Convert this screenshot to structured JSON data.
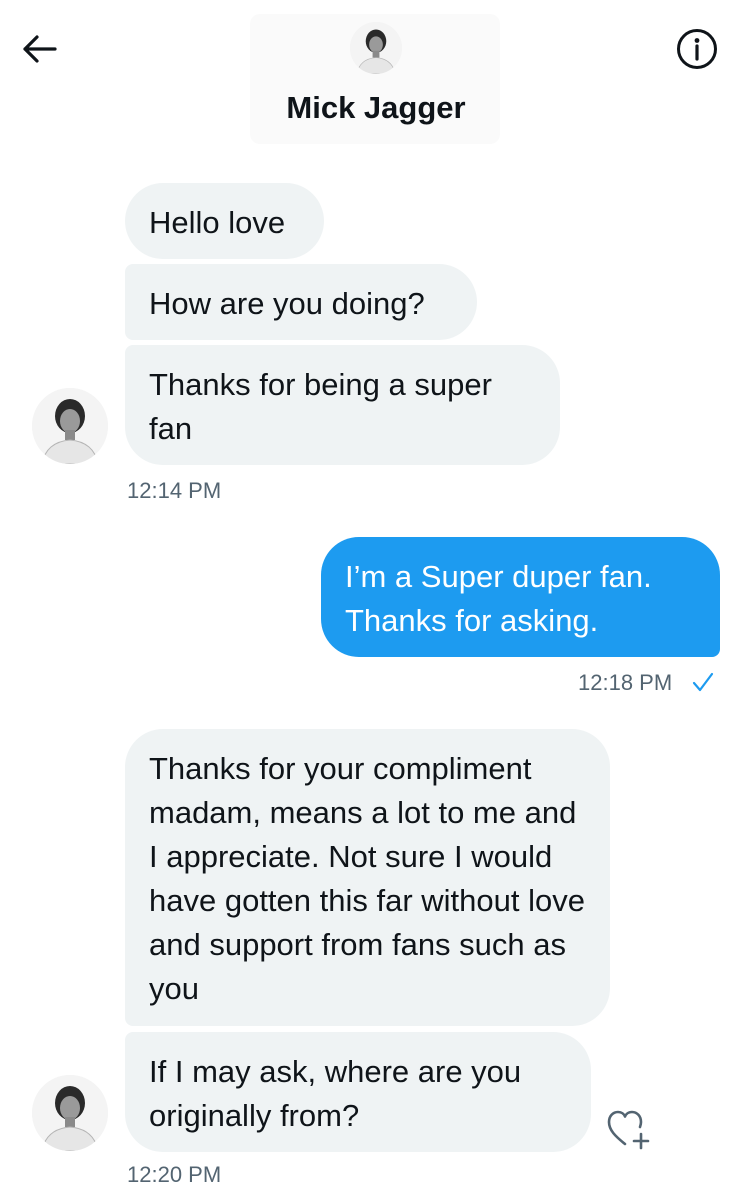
{
  "header": {
    "contact_name": "Mick Jagger",
    "back_icon": "arrow-left-icon",
    "info_icon": "info-circle-icon"
  },
  "messages": [
    {
      "direction": "incoming",
      "text": "Hello love"
    },
    {
      "direction": "incoming",
      "text": "How are you doing?"
    },
    {
      "direction": "incoming",
      "text": "Thanks for being a super fan"
    },
    {
      "direction": "outgoing",
      "text": "I’m a Super duper fan. Thanks for asking."
    },
    {
      "direction": "incoming",
      "text": "Thanks for your compliment madam, means a lot to me and I appreciate. Not sure I would have gotten this far without love and support from fans such as you"
    },
    {
      "direction": "incoming",
      "text": "If I may ask, where are you originally from?"
    }
  ],
  "timestamps": {
    "group1": "12:14 PM",
    "group2": "12:18 PM",
    "group3": "12:20 PM"
  },
  "colors": {
    "outgoing_bubble": "#1d9bf0",
    "incoming_bubble": "#eff3f4",
    "timestamp": "#536471",
    "read_check": "#1d9bf0"
  },
  "icons": {
    "read_receipt": "checkmark-icon",
    "reaction": "heart-plus-icon"
  }
}
